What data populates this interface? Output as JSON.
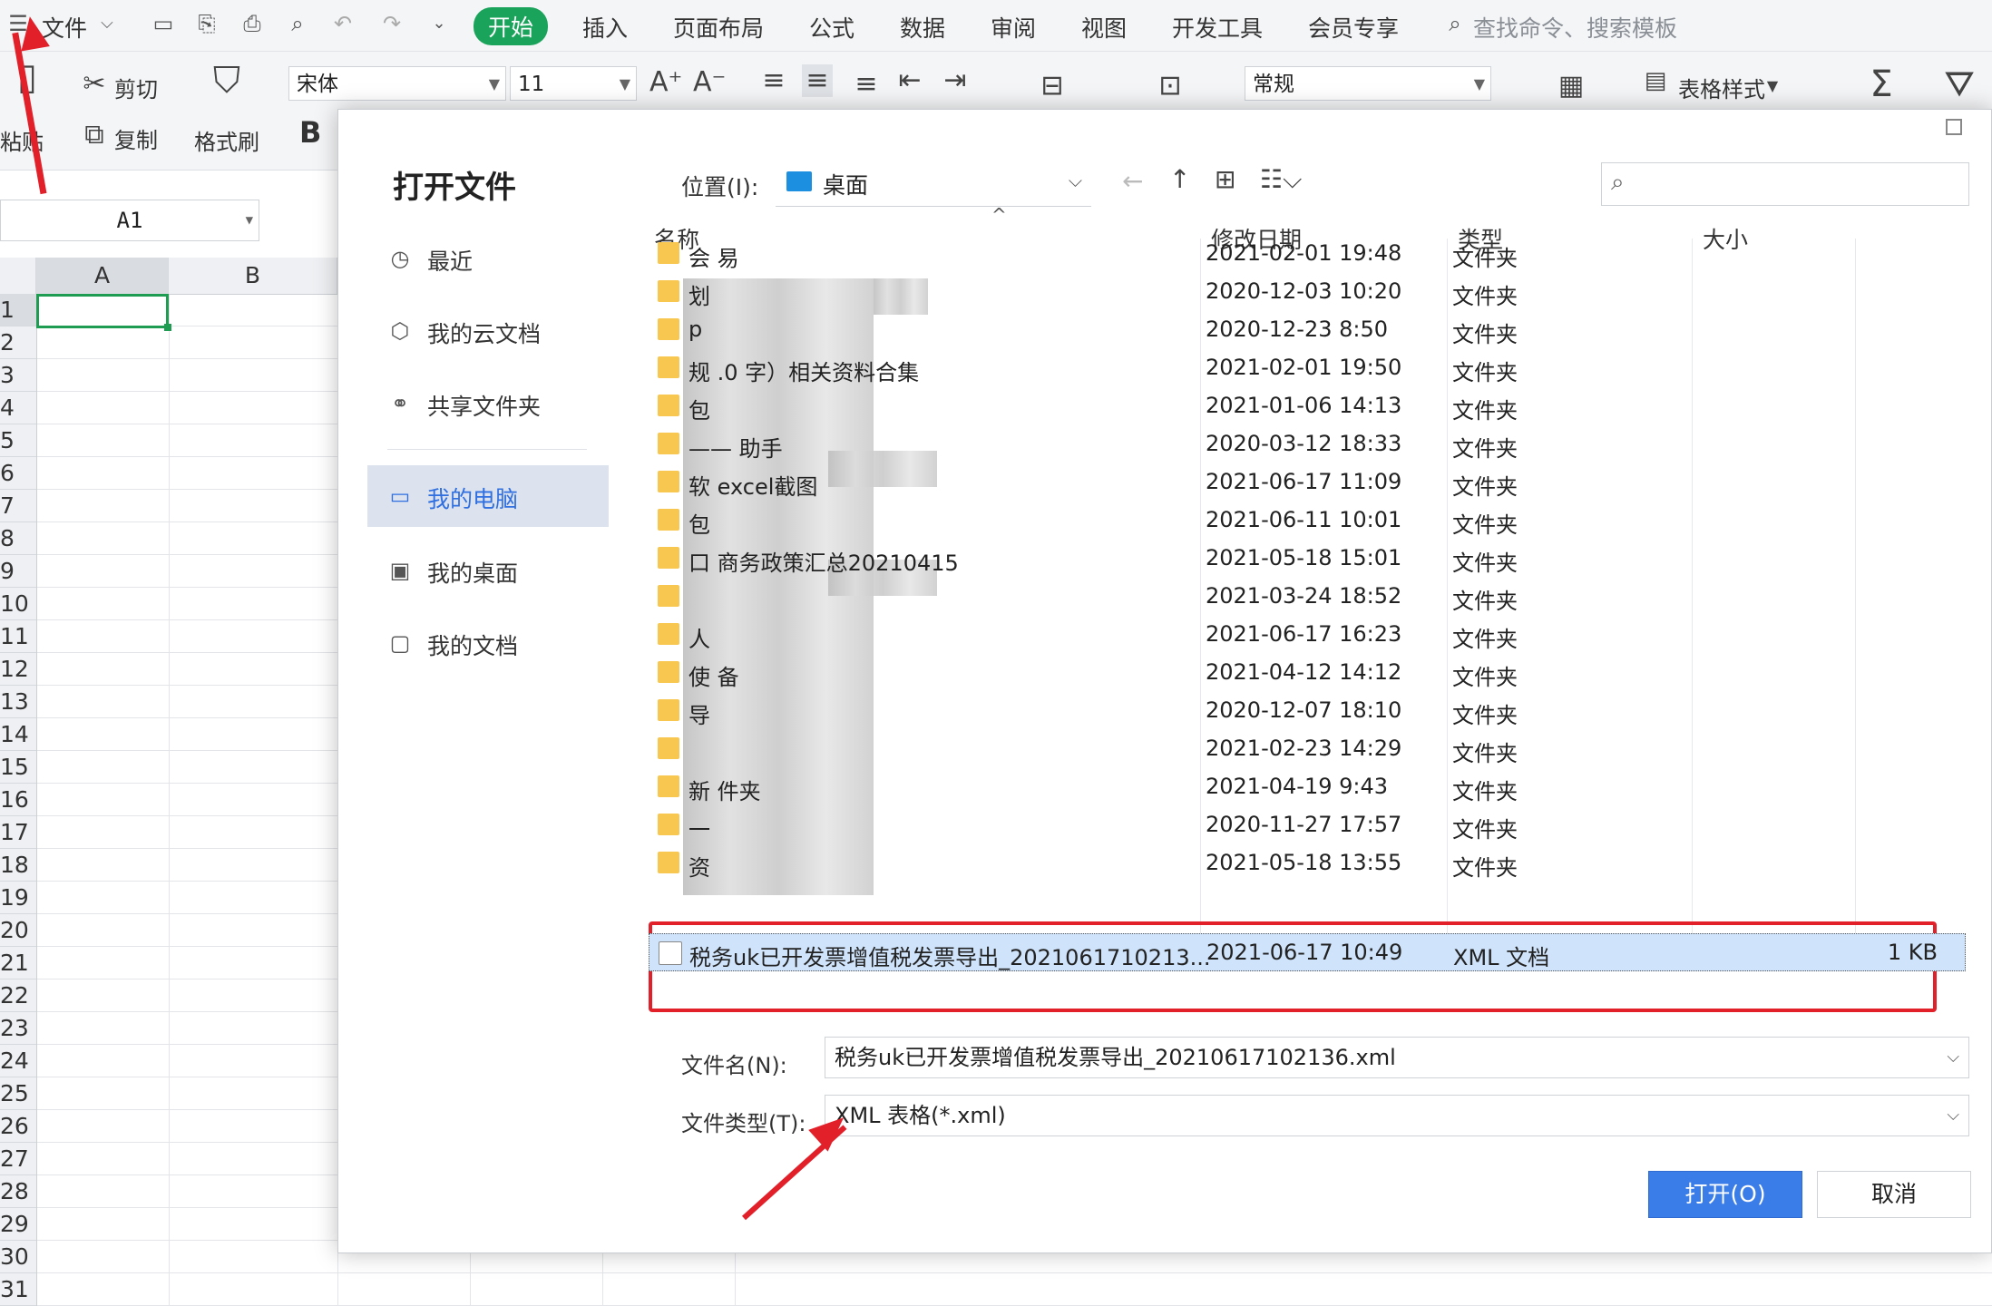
{
  "menubar": {
    "file_label": "文件",
    "tabs": [
      "开始",
      "插入",
      "页面布局",
      "公式",
      "数据",
      "审阅",
      "视图",
      "开发工具",
      "会员专享"
    ],
    "search_placeholder": "查找命令、搜索模板"
  },
  "ribbon": {
    "paste_label": "粘贴",
    "cut_label": "剪切",
    "copy_label": "复制",
    "format_painter_label": "格式刷",
    "bold_label": "B",
    "font_name": "宋体",
    "font_size": "11",
    "number_format": "常规",
    "table_style_label": "表格样式"
  },
  "namebox": {
    "value": "A1"
  },
  "grid": {
    "columns": [
      "A",
      "B"
    ],
    "rows": [
      "1",
      "2",
      "3",
      "4",
      "5",
      "6",
      "7",
      "8",
      "9",
      "10",
      "11",
      "12",
      "13",
      "14",
      "15",
      "16",
      "17",
      "18",
      "19",
      "20",
      "21",
      "22",
      "23",
      "24",
      "25",
      "26",
      "27",
      "28",
      "29",
      "30",
      "31"
    ]
  },
  "dialog": {
    "title": "打开文件",
    "sidebar": [
      {
        "label": "最近",
        "icon": "clock-icon"
      },
      {
        "label": "我的云文档",
        "icon": "cloud-icon"
      },
      {
        "label": "共享文件夹",
        "icon": "share-icon"
      },
      {
        "label": "我的电脑",
        "icon": "computer-icon"
      },
      {
        "label": "我的桌面",
        "icon": "desktop-icon"
      },
      {
        "label": "我的文档",
        "icon": "folder-icon"
      }
    ],
    "location_label": "位置(I):",
    "location_value": "桌面",
    "columns": {
      "name": "名称",
      "modified": "修改日期",
      "type": "类型",
      "size": "大小"
    },
    "files": [
      {
        "name": "会 易",
        "date": "2021-02-01 19:48",
        "type": "文件夹",
        "size": ""
      },
      {
        "name": "划",
        "date": "2020-12-03 10:20",
        "type": "文件夹",
        "size": ""
      },
      {
        "name": "p",
        "date": "2020-12-23 8:50",
        "type": "文件夹",
        "size": ""
      },
      {
        "name": "规 .0 字）相关资料合集",
        "date": "2021-02-01 19:50",
        "type": "文件夹",
        "size": ""
      },
      {
        "name": "包",
        "date": "2021-01-06 14:13",
        "type": "文件夹",
        "size": ""
      },
      {
        "name": "—— 助手",
        "date": "2020-03-12 18:33",
        "type": "文件夹",
        "size": ""
      },
      {
        "name": "软 excel截图",
        "date": "2021-06-17 11:09",
        "type": "文件夹",
        "size": ""
      },
      {
        "name": "包",
        "date": "2021-06-11 10:01",
        "type": "文件夹",
        "size": ""
      },
      {
        "name": "口 商务政策汇总20210415",
        "date": "2021-05-18 15:01",
        "type": "文件夹",
        "size": ""
      },
      {
        "name": "",
        "date": "2021-03-24 18:52",
        "type": "文件夹",
        "size": ""
      },
      {
        "name": "人",
        "date": "2021-06-17 16:23",
        "type": "文件夹",
        "size": ""
      },
      {
        "name": "使 备",
        "date": "2021-04-12 14:12",
        "type": "文件夹",
        "size": ""
      },
      {
        "name": "导",
        "date": "2020-12-07 18:10",
        "type": "文件夹",
        "size": ""
      },
      {
        "name": "",
        "date": "2021-02-23 14:29",
        "type": "文件夹",
        "size": ""
      },
      {
        "name": "新 件夹",
        "date": "2021-04-19 9:43",
        "type": "文件夹",
        "size": ""
      },
      {
        "name": "一",
        "date": "2020-11-27 17:57",
        "type": "文件夹",
        "size": ""
      },
      {
        "name": "资",
        "date": "2021-05-18 13:55",
        "type": "文件夹",
        "size": ""
      },
      {
        "name": "税务uk已开发票增值税发票导出_2021061710213...",
        "date": "2021-06-17 10:49",
        "type": "XML 文档",
        "size": "1 KB"
      }
    ],
    "filename_label": "文件名(N):",
    "filename_value": "税务uk已开发票增值税发票导出_20210617102136.xml",
    "filetype_label": "文件类型(T):",
    "filetype_value": "XML 表格(*.xml)",
    "open_label": "打开(O)",
    "cancel_label": "取消"
  }
}
